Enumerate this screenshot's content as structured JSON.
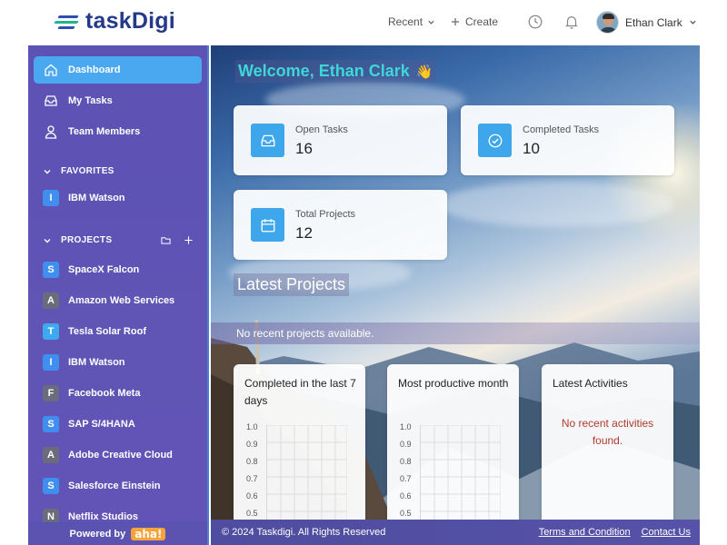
{
  "brand": {
    "name": "taskDigi"
  },
  "header": {
    "recent_label": "Recent",
    "create_label": "Create",
    "user_name": "Ethan Clark"
  },
  "sidebar": {
    "nav": [
      {
        "label": "Dashboard",
        "icon": "home-icon",
        "active": true
      },
      {
        "label": "My Tasks",
        "icon": "inbox-icon",
        "active": false
      },
      {
        "label": "Team Members",
        "icon": "user-icon",
        "active": false
      }
    ],
    "favorites_label": "FAVORITES",
    "favorites": [
      {
        "letter": "I",
        "label": "IBM Watson",
        "color": "#3f8ef0"
      }
    ],
    "projects_label": "PROJECTS",
    "projects": [
      {
        "letter": "S",
        "label": "SpaceX Falcon",
        "color": "#3f8ef0"
      },
      {
        "letter": "A",
        "label": "Amazon Web Services",
        "color": "#6b6b7b"
      },
      {
        "letter": "T",
        "label": "Tesla Solar Roof",
        "color": "#3fa9f0"
      },
      {
        "letter": "I",
        "label": "IBM Watson",
        "color": "#3f8ef0"
      },
      {
        "letter": "F",
        "label": "Facebook Meta",
        "color": "#6b6b7b"
      },
      {
        "letter": "S",
        "label": "SAP S/4HANA",
        "color": "#3f8ef0"
      },
      {
        "letter": "A",
        "label": "Adobe Creative Cloud",
        "color": "#6b6b7b"
      },
      {
        "letter": "S",
        "label": "Salesforce Einstein",
        "color": "#3f8ef0"
      },
      {
        "letter": "N",
        "label": "Netflix Studios",
        "color": "#6b6b7b"
      }
    ],
    "powered_by": "Powered by",
    "powered_logo": "aha!"
  },
  "main": {
    "welcome": "Welcome, Ethan Clark",
    "wave_emoji": "👋",
    "stats": [
      {
        "label": "Open Tasks",
        "value": "16",
        "icon": "inbox-icon"
      },
      {
        "label": "Completed Tasks",
        "value": "10",
        "icon": "check-circle-icon"
      },
      {
        "label": "Total Projects",
        "value": "12",
        "icon": "calendar-icon"
      }
    ],
    "latest_projects_title": "Latest Projects",
    "no_projects": "No recent projects available.",
    "cards": {
      "completed_title": "Completed in the last 7 days",
      "productive_title": "Most productive month",
      "activities_title": "Latest Activities",
      "no_activities": "No recent activities found.",
      "y_ticks": [
        "1.0",
        "0.9",
        "0.8",
        "0.7",
        "0.6",
        "0.5"
      ]
    }
  },
  "footer": {
    "copyright": "© 2024 Taskdigi. All Rights Reserved",
    "terms": "Terms and Condition",
    "contact": "Contact Us"
  },
  "colors": {
    "sidebar_bg": "#5d53b4",
    "active_item": "#4aa8f0",
    "welcome_text": "#3fd6d8",
    "stat_icon_bg": "#3ea6ea",
    "no_activity_text": "#b03a2e"
  }
}
